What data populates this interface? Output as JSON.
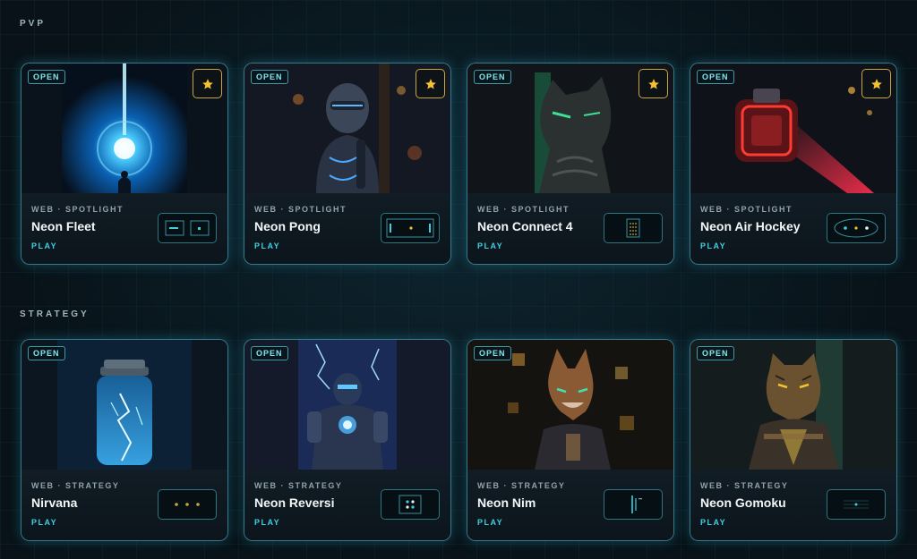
{
  "sections": [
    {
      "title": "PVP",
      "cards": [
        {
          "badge": "OPEN",
          "meta": "WEB · SPOTLIGHT",
          "title": "Neon Fleet",
          "play": "PLAY",
          "starred": true
        },
        {
          "badge": "OPEN",
          "meta": "WEB · SPOTLIGHT",
          "title": "Neon Pong",
          "play": "PLAY",
          "starred": true
        },
        {
          "badge": "OPEN",
          "meta": "WEB · SPOTLIGHT",
          "title": "Neon Connect 4",
          "play": "PLAY",
          "starred": true
        },
        {
          "badge": "OPEN",
          "meta": "WEB · SPOTLIGHT",
          "title": "Neon Air Hockey",
          "play": "PLAY",
          "starred": true
        }
      ]
    },
    {
      "title": "STRATEGY",
      "cards": [
        {
          "badge": "OPEN",
          "meta": "WEB · STRATEGY",
          "title": "Nirvana",
          "play": "PLAY",
          "starred": false
        },
        {
          "badge": "OPEN",
          "meta": "WEB · STRATEGY",
          "title": "Neon Reversi",
          "play": "PLAY",
          "starred": false
        },
        {
          "badge": "OPEN",
          "meta": "WEB · STRATEGY",
          "title": "Neon Nim",
          "play": "PLAY",
          "starred": false
        },
        {
          "badge": "OPEN",
          "meta": "WEB · STRATEGY",
          "title": "Neon Gomoku",
          "play": "PLAY",
          "starred": false
        }
      ]
    }
  ],
  "icons": {
    "star": "star-icon"
  },
  "colors": {
    "accent": "#3fd0e0",
    "star": "#f2c230",
    "background": "#081218"
  }
}
